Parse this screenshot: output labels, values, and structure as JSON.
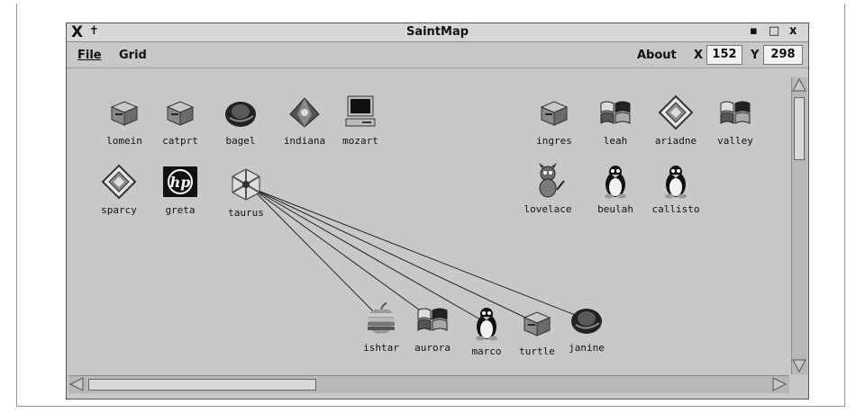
{
  "window": {
    "title": "SaintMap",
    "close_glyph": "X",
    "pin_glyph": "✝",
    "min_glyph": "▪",
    "max_glyph": "□",
    "close_btn_glyph": "x"
  },
  "menubar": {
    "file": "File",
    "grid": "Grid",
    "about": "About"
  },
  "coords": {
    "x_label": "X",
    "x_value": "152",
    "y_label": "Y",
    "y_value": "298"
  },
  "hosts": [
    {
      "name": "lomein",
      "icon": "printer-icon"
    },
    {
      "name": "catprt",
      "icon": "printer-icon"
    },
    {
      "name": "bagel",
      "icon": "redhat-icon"
    },
    {
      "name": "indiana",
      "icon": "gem-icon"
    },
    {
      "name": "mozart",
      "icon": "workstation-icon"
    },
    {
      "name": "ingres",
      "icon": "printer-icon"
    },
    {
      "name": "leah",
      "icon": "windows-icon"
    },
    {
      "name": "ariadne",
      "icon": "diamond-icon"
    },
    {
      "name": "valley",
      "icon": "windows-icon"
    },
    {
      "name": "sparcy",
      "icon": "diamond-icon"
    },
    {
      "name": "greta",
      "icon": "hp-icon"
    },
    {
      "name": "taurus",
      "icon": "router-icon"
    },
    {
      "name": "lovelace",
      "icon": "bsd-daemon-icon"
    },
    {
      "name": "beulah",
      "icon": "tux-icon"
    },
    {
      "name": "callisto",
      "icon": "tux-icon"
    },
    {
      "name": "ishtar",
      "icon": "apple-icon"
    },
    {
      "name": "aurora",
      "icon": "windows-icon"
    },
    {
      "name": "marco",
      "icon": "tux-icon"
    },
    {
      "name": "turtle",
      "icon": "printer-icon"
    },
    {
      "name": "janine",
      "icon": "redhat-icon"
    }
  ],
  "hp_text": "hp",
  "links": [
    [
      "taurus",
      "ishtar"
    ],
    [
      "taurus",
      "aurora"
    ],
    [
      "taurus",
      "marco"
    ],
    [
      "taurus",
      "turtle"
    ],
    [
      "taurus",
      "janine"
    ]
  ]
}
